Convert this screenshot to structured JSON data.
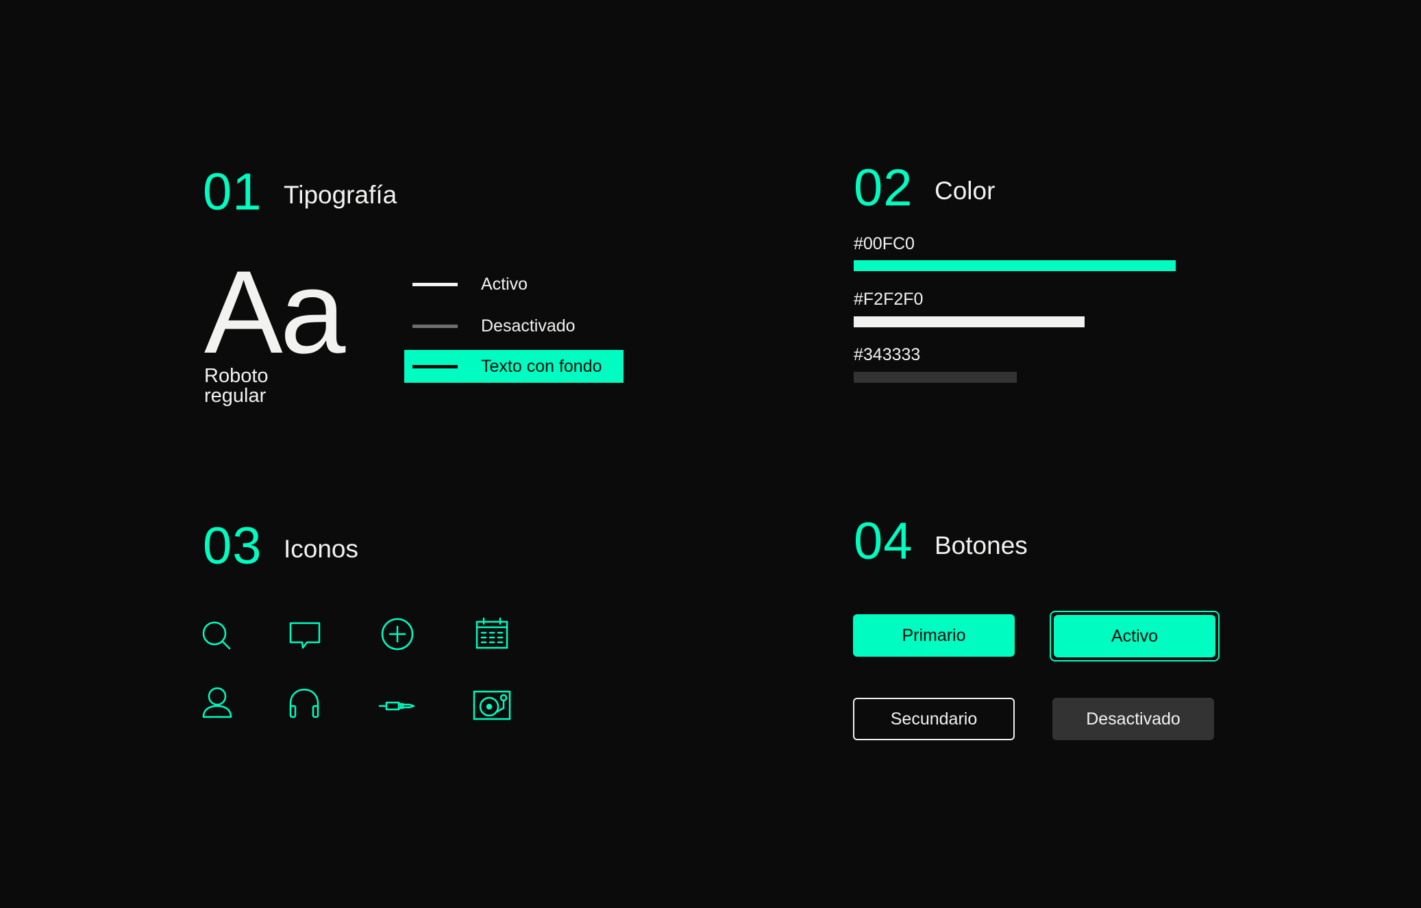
{
  "colors": {
    "background": "#0B0B0B",
    "accent": "#00FCC0",
    "light": "#F2F2F0",
    "dark": "#343333",
    "muted_line": "#6E6E6E"
  },
  "typography": {
    "number": "01",
    "title": "Tipografía",
    "sample": "Aa",
    "font_name": "Roboto regular",
    "states": [
      {
        "label": "Activo"
      },
      {
        "label": "Desactivado"
      },
      {
        "label": "Texto con fondo"
      }
    ]
  },
  "color": {
    "number": "02",
    "title": "Color",
    "swatches": [
      {
        "hex": "#00FC0",
        "value": "#00FCC0"
      },
      {
        "hex": "#F2F2F0",
        "value": "#F2F2F0"
      },
      {
        "hex": "#343333",
        "value": "#343333"
      }
    ]
  },
  "icons": {
    "number": "03",
    "title": "Iconos",
    "items": [
      {
        "name": "search-icon"
      },
      {
        "name": "chat-icon"
      },
      {
        "name": "add-circle-icon"
      },
      {
        "name": "calendar-icon"
      },
      {
        "name": "user-icon"
      },
      {
        "name": "headphones-icon"
      },
      {
        "name": "audio-jack-icon"
      },
      {
        "name": "turntable-icon"
      }
    ]
  },
  "buttons": {
    "number": "04",
    "title": "Botones",
    "primary": "Primario",
    "active": "Activo",
    "secondary": "Secundario",
    "disabled": "Desactivado"
  }
}
